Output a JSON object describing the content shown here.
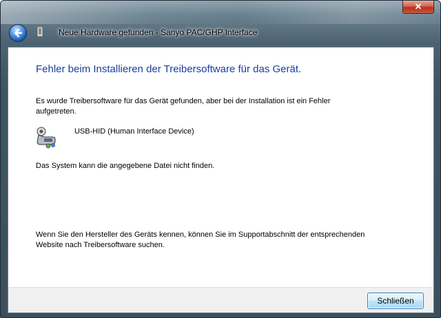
{
  "window": {
    "title": "Neue Hardware gefunden - Sanyo PAC/GHP Interface",
    "close_glyph": "✕"
  },
  "content": {
    "heading": "Fehler beim Installieren der Treibersoftware für das Gerät.",
    "intro": "Es wurde Treibersoftware für das Gerät gefunden, aber bei der Installation ist ein Fehler aufgetreten.",
    "device_name": "USB-HID (Human Interface Device)",
    "error_message": "Das System kann die angegebene Datei nicht finden.",
    "hint": "Wenn Sie den Hersteller des Geräts kennen, können Sie im Supportabschnitt der entsprechenden Website nach Treibersoftware suchen."
  },
  "footer": {
    "close_label": "Schließen"
  },
  "icons": {
    "back": "back-arrow-icon",
    "title": "hardware-icon",
    "device": "usb-device-icon",
    "close": "close-icon"
  },
  "colors": {
    "heading": "#1a3e9e",
    "close_red": "#c9533b",
    "button_border": "#3c7fb1"
  }
}
